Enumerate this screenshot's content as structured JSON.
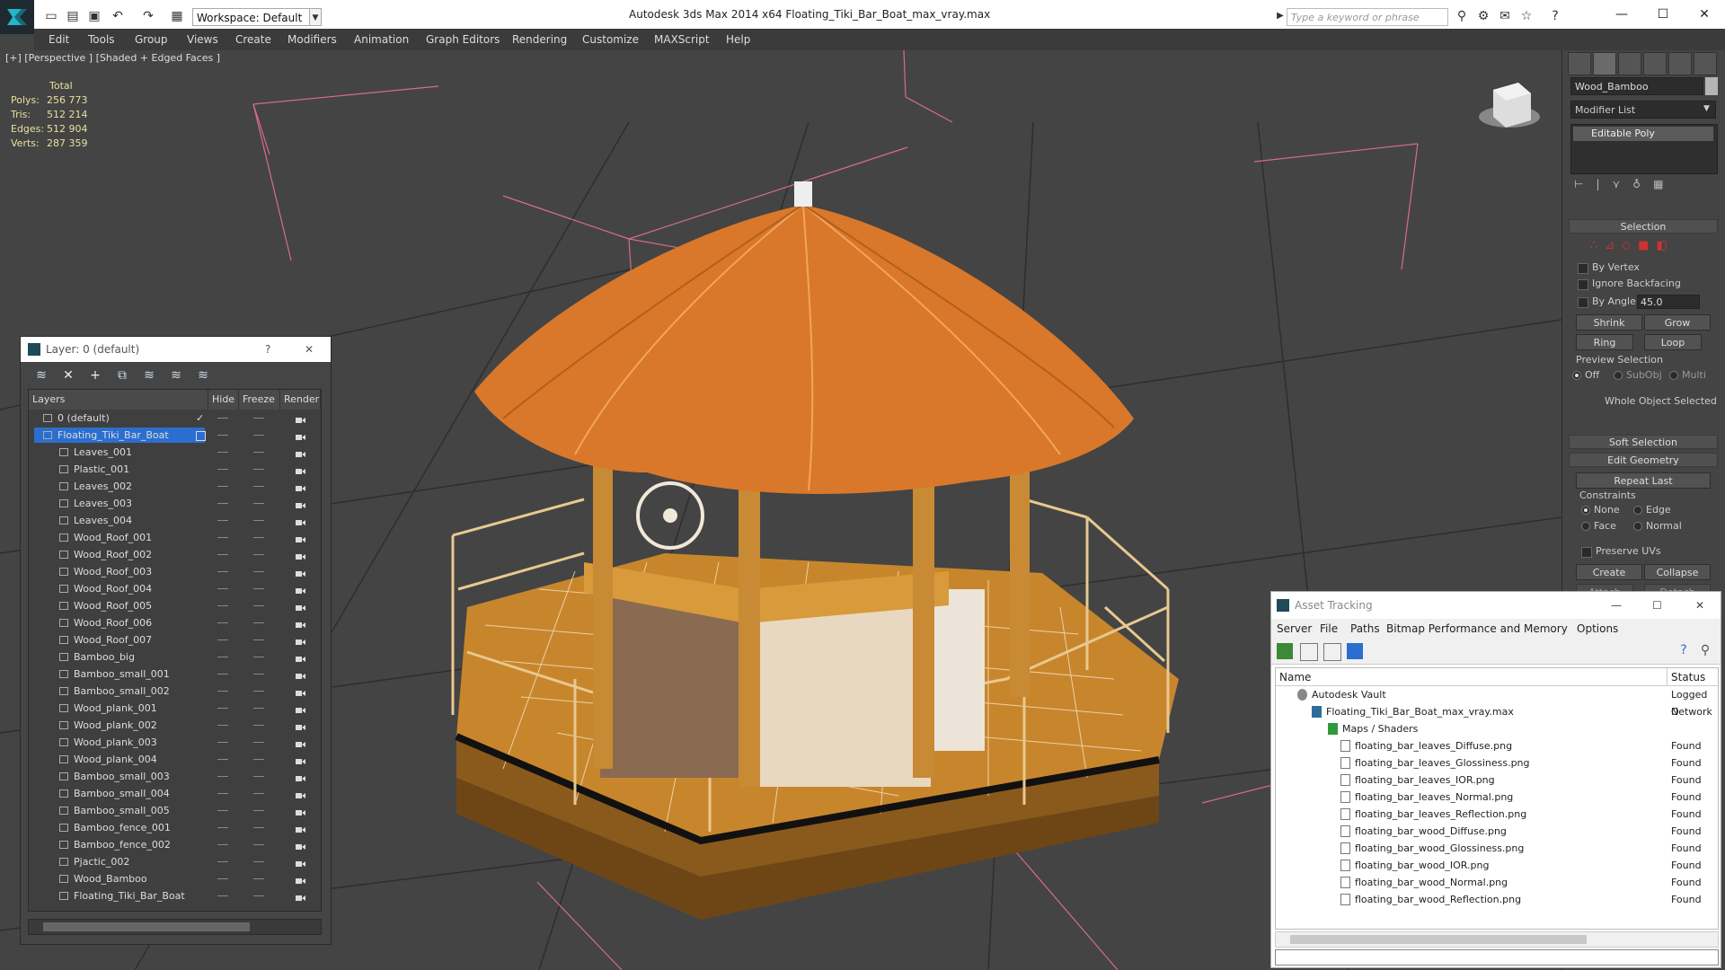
{
  "app": {
    "title": "Autodesk 3ds Max  2014 x64      Floating_Tiki_Bar_Boat_max_vray.max",
    "workspace": "Workspace: Default",
    "search_placeholder": "Type a keyword or phrase"
  },
  "menu": [
    "Edit",
    "Tools",
    "Group",
    "Views",
    "Create",
    "Modifiers",
    "Animation",
    "Graph Editors",
    "Rendering",
    "Customize",
    "MAXScript",
    "Help"
  ],
  "viewport": {
    "label": "[+] [Perspective ] [Shaded + Edged Faces ]",
    "stats_header": "Total",
    "stats": [
      {
        "label": "Polys:",
        "value": "256 773"
      },
      {
        "label": "Tris:",
        "value": "512 214"
      },
      {
        "label": "Edges:",
        "value": "512 904"
      },
      {
        "label": "Verts:",
        "value": "287 359"
      }
    ]
  },
  "command_panel": {
    "object_name": "Wood_Bamboo",
    "modifier_list": "Modifier List",
    "stack_item": "Editable Poly",
    "selection": {
      "header": "Selection",
      "by_vertex": "By Vertex",
      "ignore_backfacing": "Ignore Backfacing",
      "by_angle": "By Angle:",
      "angle_value": "45.0",
      "shrink": "Shrink",
      "grow": "Grow",
      "ring": "Ring",
      "loop": "Loop",
      "preview_selection": "Preview Selection",
      "preview_off": "Off",
      "preview_subobj": "SubObj",
      "preview_multi": "Multi",
      "whole_object": "Whole Object Selected"
    },
    "soft_selection": "Soft Selection",
    "edit_geometry": {
      "header": "Edit Geometry",
      "repeat_last": "Repeat Last",
      "constraints": "Constraints",
      "none": "None",
      "edge": "Edge",
      "face": "Face",
      "normal": "Normal",
      "preserve_uvs": "Preserve UVs",
      "create": "Create",
      "collapse": "Collapse",
      "attach": "Attach",
      "detach": "Detach"
    }
  },
  "layer_window": {
    "title": "Layer: 0 (default)",
    "help": "?",
    "close": "✕",
    "columns": [
      "Layers",
      "Hide",
      "Freeze",
      "Render"
    ],
    "rows": [
      {
        "name": "0 (default)",
        "level": 0,
        "check": true
      },
      {
        "name": "Floating_Tiki_Bar_Boat",
        "level": 0,
        "selected": true
      },
      {
        "name": "Leaves_001",
        "level": 1
      },
      {
        "name": "Plastic_001",
        "level": 1
      },
      {
        "name": "Leaves_002",
        "level": 1
      },
      {
        "name": "Leaves_003",
        "level": 1
      },
      {
        "name": "Leaves_004",
        "level": 1
      },
      {
        "name": "Wood_Roof_001",
        "level": 1
      },
      {
        "name": "Wood_Roof_002",
        "level": 1
      },
      {
        "name": "Wood_Roof_003",
        "level": 1
      },
      {
        "name": "Wood_Roof_004",
        "level": 1
      },
      {
        "name": "Wood_Roof_005",
        "level": 1
      },
      {
        "name": "Wood_Roof_006",
        "level": 1
      },
      {
        "name": "Wood_Roof_007",
        "level": 1
      },
      {
        "name": "Bamboo_big",
        "level": 1
      },
      {
        "name": "Bamboo_small_001",
        "level": 1
      },
      {
        "name": "Bamboo_small_002",
        "level": 1
      },
      {
        "name": "Wood_plank_001",
        "level": 1
      },
      {
        "name": "Wood_plank_002",
        "level": 1
      },
      {
        "name": "Wood_plank_003",
        "level": 1
      },
      {
        "name": "Wood_plank_004",
        "level": 1
      },
      {
        "name": "Bamboo_small_003",
        "level": 1
      },
      {
        "name": "Bamboo_small_004",
        "level": 1
      },
      {
        "name": "Bamboo_small_005",
        "level": 1
      },
      {
        "name": "Bamboo_fence_001",
        "level": 1
      },
      {
        "name": "Bamboo_fence_002",
        "level": 1
      },
      {
        "name": "Pjactic_002",
        "level": 1
      },
      {
        "name": "Wood_Bamboo",
        "level": 1
      },
      {
        "name": "Floating_Tiki_Bar_Boat",
        "level": 1
      }
    ]
  },
  "asset_window": {
    "title": "Asset Tracking",
    "menu": [
      "Server",
      "File",
      "Paths",
      "Bitmap Performance and Memory",
      "Options"
    ],
    "columns": [
      "Name",
      "Status"
    ],
    "rows": [
      {
        "name": "Autodesk Vault",
        "status": "Logged O",
        "level": 0,
        "kind": "vault"
      },
      {
        "name": "Floating_Tiki_Bar_Boat_max_vray.max",
        "status": "Network",
        "level": 1,
        "kind": "max"
      },
      {
        "name": "Maps / Shaders",
        "status": "",
        "level": 2,
        "kind": "folder"
      },
      {
        "name": "floating_bar_leaves_Diffuse.png",
        "status": "Found",
        "level": 3,
        "kind": "file"
      },
      {
        "name": "floating_bar_leaves_Glossiness.png",
        "status": "Found",
        "level": 3,
        "kind": "file"
      },
      {
        "name": "floating_bar_leaves_IOR.png",
        "status": "Found",
        "level": 3,
        "kind": "file"
      },
      {
        "name": "floating_bar_leaves_Normal.png",
        "status": "Found",
        "level": 3,
        "kind": "file"
      },
      {
        "name": "floating_bar_leaves_Reflection.png",
        "status": "Found",
        "level": 3,
        "kind": "file"
      },
      {
        "name": "floating_bar_wood_Diffuse.png",
        "status": "Found",
        "level": 3,
        "kind": "file"
      },
      {
        "name": "floating_bar_wood_Glossiness.png",
        "status": "Found",
        "level": 3,
        "kind": "file"
      },
      {
        "name": "floating_bar_wood_IOR.png",
        "status": "Found",
        "level": 3,
        "kind": "file"
      },
      {
        "name": "floating_bar_wood_Normal.png",
        "status": "Found",
        "level": 3,
        "kind": "file"
      },
      {
        "name": "floating_bar_wood_Reflection.png",
        "status": "Found",
        "level": 3,
        "kind": "file"
      }
    ]
  },
  "colors": {
    "selection_blue": "#2b6ecf",
    "thatch": "#d9782a",
    "wood": "#c98a2e",
    "stats_text": "#e8e0a0"
  }
}
